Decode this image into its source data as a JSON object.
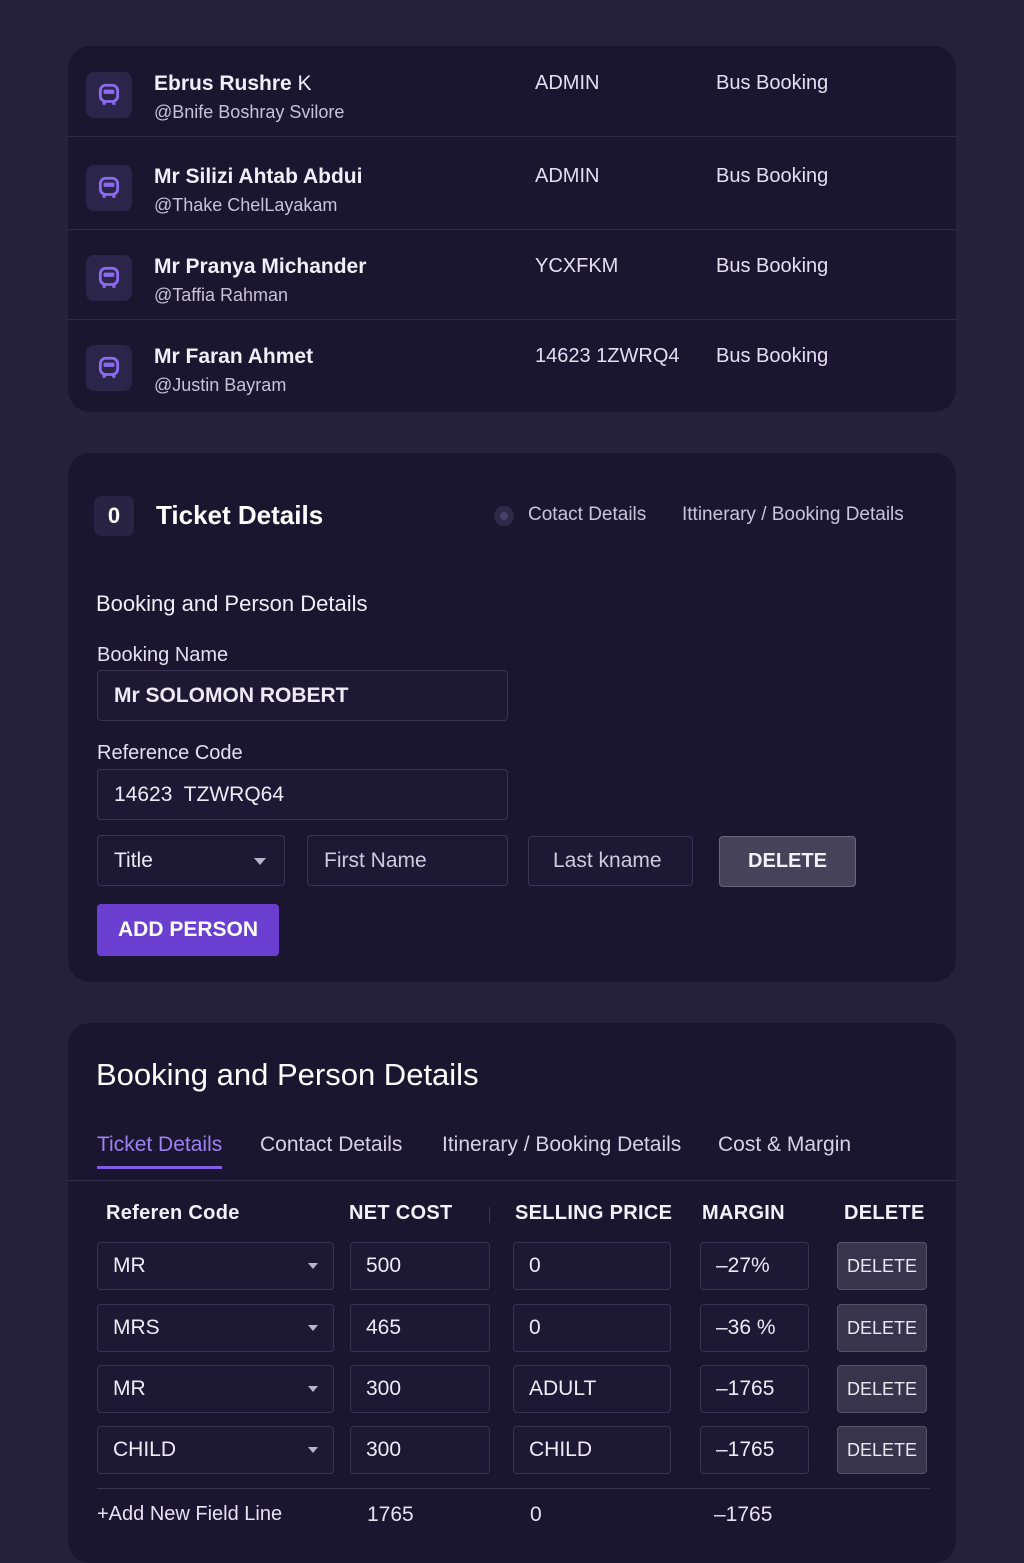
{
  "users": [
    {
      "name": "Ebrus Rushre",
      "suffix": "K",
      "handle": "@Bnife Boshray Svilore",
      "role": "ADMIN",
      "type": "Bus Booking"
    },
    {
      "name": "Mr Silizi Ahtab Abdui",
      "suffix": "",
      "handle": "@Thake ChelLayakam",
      "role": "ADMIN",
      "type": "Bus Booking"
    },
    {
      "name": "Mr Pranya Michander",
      "suffix": "",
      "handle": "@Taffia Rahman",
      "role": "YCXFKM",
      "type": "Bus Booking"
    },
    {
      "name": "Mr Faran Ahmet",
      "suffix": "",
      "handle": "@Justin Bayram",
      "role": "14623 1ZWRQ4",
      "type": "Bus Booking"
    }
  ],
  "ticket": {
    "badge": "0",
    "title": "Ticket Details",
    "steps": [
      "Cotact Details",
      "Ittinerary / Booking Details"
    ],
    "section_title": "Booking and Person Details",
    "booking_name_label": "Booking Name",
    "booking_name_value": "Mr SOLOMON ROBERT",
    "reference_label": "Reference Code",
    "reference_value": "14623  TZWRQ64",
    "title_select": "Title",
    "first_name_placeholder": "First Name",
    "last_name_placeholder": "Last kname",
    "delete_label": "DELETE",
    "add_person_label": "ADD PERSON"
  },
  "costs": {
    "title": "Booking and Person Details",
    "tabs": [
      "Ticket Details",
      "Contact Details",
      "Itinerary / Booking Details",
      "Cost & Margin"
    ],
    "active_tab": "Ticket Details",
    "headers": [
      "Referen Code",
      "NET COST",
      "SELLING PRICE",
      "MARGIN",
      "DELETE"
    ],
    "rows": [
      {
        "code": "MR",
        "net": "500",
        "selling": "0",
        "margin": "–27%",
        "delete": "DELETE"
      },
      {
        "code": "MRS",
        "net": "465",
        "selling": "0",
        "margin": "–36 %",
        "delete": "DELETE"
      },
      {
        "code": "MR",
        "net": "300",
        "selling": "ADULT",
        "margin": "–1765",
        "delete": "DELETE"
      },
      {
        "code": "CHILD",
        "net": "300",
        "selling": "CHILD",
        "margin": "–1765",
        "delete": "DELETE"
      }
    ],
    "footer": {
      "add_label": "+Add New Field Line",
      "net_total": "1765",
      "selling_total": "0",
      "margin_total": "–1765"
    }
  },
  "colors": {
    "background": "#25213a",
    "card": "#1b1630",
    "accent": "#6a3fd0",
    "active_tab": "#9b83f0",
    "icon": "#8b6cf0"
  }
}
